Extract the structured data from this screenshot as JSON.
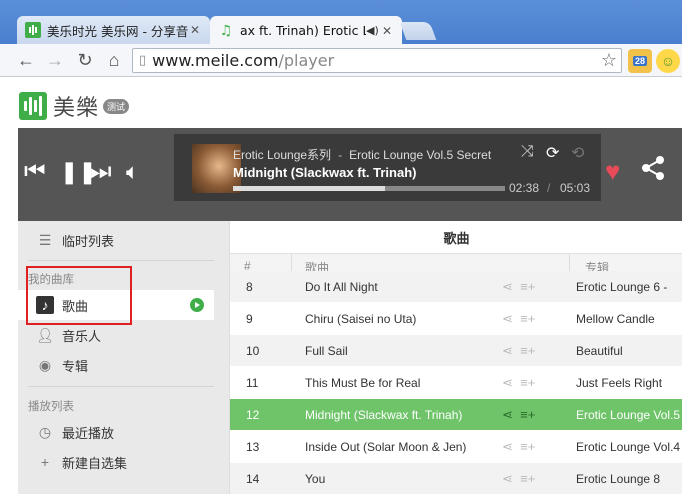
{
  "browser": {
    "tabs": [
      {
        "title": "美乐时光 美乐网 - 分享音",
        "active": false
      },
      {
        "title": "ax ft. Trinah) Erotic Lo",
        "active": true
      }
    ],
    "url_host": "www.meile.com",
    "url_path": "/player",
    "ext_badge": "28"
  },
  "logo": {
    "text": "美樂",
    "badge": "测试"
  },
  "player": {
    "line1_left": "Erotic Lounge系列",
    "line1_sep": "-",
    "line1_right": "Erotic Lounge Vol.5 Secret",
    "title": "Midnight (Slackwax ft. Trinah)",
    "elapsed": "02:38",
    "time_sep": "/",
    "duration": "05:03",
    "progress": 0.56
  },
  "sidebar": {
    "temp_list": "临时列表",
    "library_head": "我的曲库",
    "items": [
      "歌曲",
      "音乐人",
      "专辑"
    ],
    "playlist_head": "播放列表",
    "recent": "最近播放",
    "new_list": "新建自选集"
  },
  "main": {
    "heading": "歌曲",
    "columns": {
      "num": "#",
      "song": "歌曲",
      "album": "专辑"
    },
    "rows": [
      {
        "num": "8",
        "song": "Do It All Night",
        "album": "Erotic Lounge 6 -"
      },
      {
        "num": "9",
        "song": "Chiru (Saisei no Uta)",
        "album": "Mellow Candle"
      },
      {
        "num": "10",
        "song": "Full Sail",
        "album": "Beautiful"
      },
      {
        "num": "11",
        "song": "This Must Be for Real",
        "album": "Just Feels Right"
      },
      {
        "num": "12",
        "song": "Midnight (Slackwax ft. Trinah)",
        "album": "Erotic Lounge Vol.5"
      },
      {
        "num": "13",
        "song": "Inside Out (Solar Moon & Jen)",
        "album": "Erotic Lounge Vol.4"
      },
      {
        "num": "14",
        "song": "You",
        "album": "Erotic Lounge 8"
      }
    ]
  },
  "colors": {
    "brand_green": "#3fae49",
    "heart": "#e84a58",
    "active_row": "#6fc46a"
  }
}
